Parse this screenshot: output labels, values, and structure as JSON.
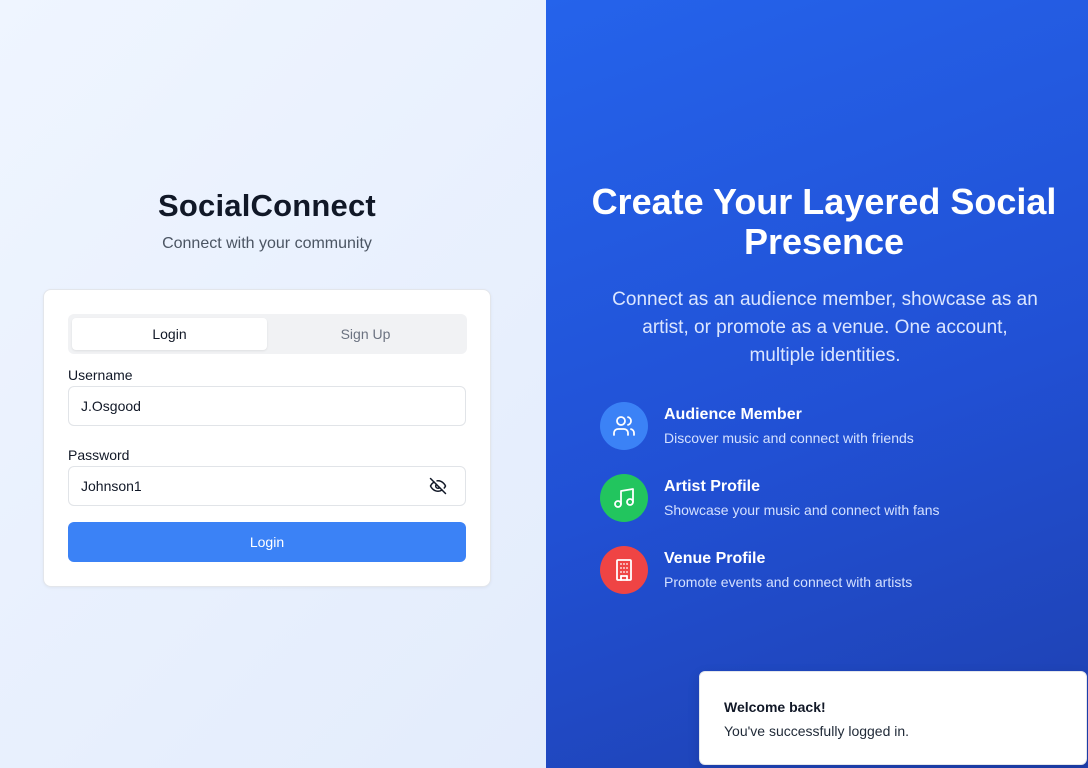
{
  "brand": {
    "title": "SocialConnect",
    "subtitle": "Connect with your community"
  },
  "auth": {
    "tabs": [
      "Login",
      "Sign Up"
    ],
    "active_tab": "Login",
    "username_label": "Username",
    "username_value": "J.Osgood",
    "password_label": "Password",
    "password_value": "Johnson1",
    "password_toggle_icon": "eye-off-icon",
    "submit_label": "Login"
  },
  "hero": {
    "title": "Create Your Layered Social Presence",
    "description": "Connect as an audience member, showcase as an artist, or promote as a venue. One account, multiple identities."
  },
  "features": [
    {
      "title": "Audience Member",
      "description": "Discover music and connect with friends",
      "icon": "users-icon",
      "color": "#3b82f6"
    },
    {
      "title": "Artist Profile",
      "description": "Showcase your music and connect with fans",
      "icon": "music-icon",
      "color": "#22c55e"
    },
    {
      "title": "Venue Profile",
      "description": "Promote events and connect with artists",
      "icon": "building-icon",
      "color": "#ef4444"
    }
  ],
  "toast": {
    "title": "Welcome back!",
    "message": "You've successfully logged in."
  },
  "colors": {
    "primary": "#3b82f6",
    "hero_gradient_start": "#2563eb",
    "hero_gradient_end": "#1e40af"
  }
}
